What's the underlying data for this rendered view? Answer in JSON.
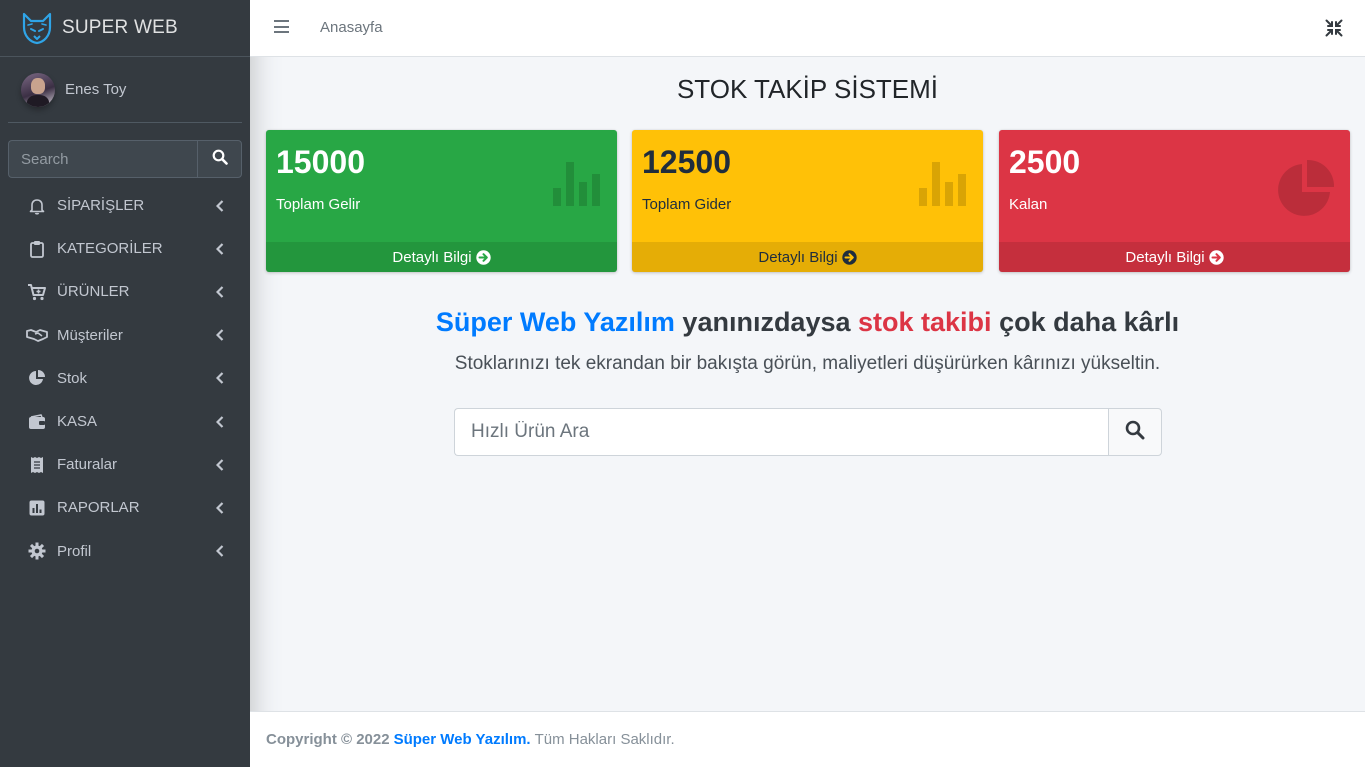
{
  "brand": {
    "name": "SUPER WEB"
  },
  "user": {
    "name": "Enes Toy"
  },
  "sidebar_search": {
    "placeholder": "Search"
  },
  "nav": {
    "items": [
      {
        "label": "SİPARİŞLER",
        "icon": "bell-icon"
      },
      {
        "label": "KATEGORİLER",
        "icon": "clipboard-icon"
      },
      {
        "label": "ÜRÜNLER",
        "icon": "cart-plus-icon"
      },
      {
        "label": "Müşteriler",
        "icon": "handshake-icon"
      },
      {
        "label": "Stok",
        "icon": "pie-chart-icon"
      },
      {
        "label": "KASA",
        "icon": "wallet-icon"
      },
      {
        "label": "Faturalar",
        "icon": "receipt-icon"
      },
      {
        "label": "RAPORLAR",
        "icon": "bar-chart-icon"
      },
      {
        "label": "Profil",
        "icon": "gear-icon"
      }
    ]
  },
  "header": {
    "home_link": "Anasayfa"
  },
  "main": {
    "title": "STOK TAKİP SİSTEMİ",
    "boxes": [
      {
        "value": "15000",
        "label": "Toplam Gelir",
        "more": "Detaylı Bilgi",
        "color": "#28a745",
        "icon": "bar-chart-icon"
      },
      {
        "value": "12500",
        "label": "Toplam Gider",
        "more": "Detaylı Bilgi",
        "color": "#ffc107",
        "icon": "bar-chart-icon"
      },
      {
        "value": "2500",
        "label": "Kalan",
        "more": "Detaylı Bilgi",
        "color": "#dc3545",
        "icon": "pie-chart-icon"
      }
    ],
    "headline": {
      "part1": "Süper Web Yazılım",
      "part2": " yanınızdaysa ",
      "part3": "stok takibi",
      "part4": " çok daha kârlı"
    },
    "subline": "Stoklarınızı tek ekrandan bir bakışta görün, maliyetleri düşürürken kârınızı yükseltin.",
    "quick_search": {
      "placeholder": "Hızlı Ürün Ara"
    }
  },
  "footer": {
    "copyright": "Copyright © 2022",
    "company": "Süper Web Yazılım.",
    "rights": "Tüm Hakları Saklıdır."
  }
}
